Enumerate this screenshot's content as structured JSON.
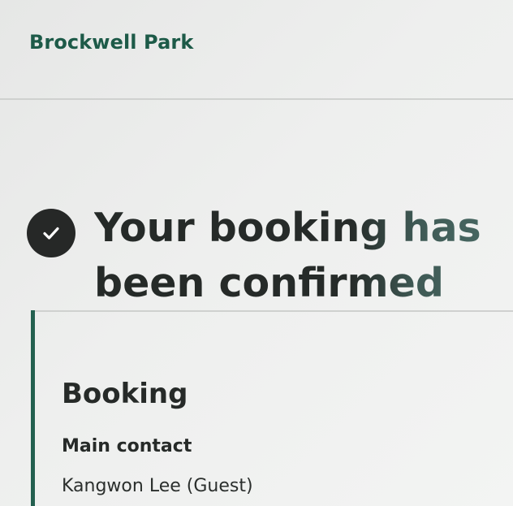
{
  "header": {
    "brand": "Brockwell Park"
  },
  "confirmation": {
    "icon": "check-circle-icon",
    "headline": "Your booking has been confirmed"
  },
  "booking": {
    "section_title": "Booking",
    "main_contact_label": "Main contact",
    "main_contact_value": "Kangwon Lee (Guest)"
  },
  "colors": {
    "brand": "#1d5a48",
    "accent_bar": "#23604f",
    "text": "#262a28",
    "icon_bg": "#262827"
  }
}
